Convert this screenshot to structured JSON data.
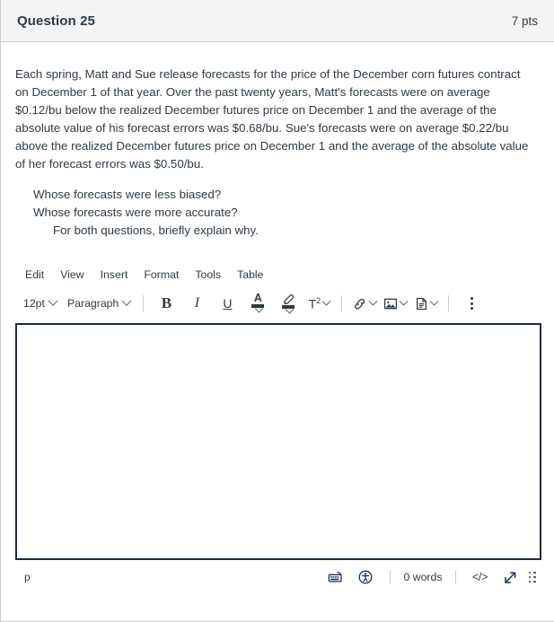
{
  "header": {
    "title": "Question 25",
    "points": "7 pts"
  },
  "question": {
    "paragraph": "Each spring, Matt and Sue release forecasts for the price of the December corn futures contract on December 1 of that year. Over the past twenty years, Matt's forecasts were on average $0.12/bu below the realized December futures price on December 1 and the average of the absolute value of his forecast errors was $0.68/bu. Sue's forecasts were on average $0.22/bu above the realized December futures price on December 1 and the average of the absolute value of her forecast errors was $0.50/bu.",
    "sub_questions": [
      "Whose forecasts were less biased?",
      "Whose forecasts were more accurate?",
      "For both questions, briefly explain why."
    ]
  },
  "editor": {
    "menubar": [
      "Edit",
      "View",
      "Insert",
      "Format",
      "Tools",
      "Table"
    ],
    "toolbar": {
      "font_size": "12pt",
      "block_format": "Paragraph",
      "bold": "B",
      "italic": "I",
      "underline": "U",
      "text_color_glyph": "A",
      "superscript_glyph": "T",
      "superscript_exponent": "2",
      "icons": {
        "text_color": "text-color-icon",
        "highlight": "highlighter-icon",
        "superscript": "superscript-icon",
        "link": "link-icon",
        "image": "image-icon",
        "document": "document-icon",
        "more": "more-options-icon"
      }
    },
    "content": "",
    "statusbar": {
      "element_path": "p",
      "word_count": "0 words",
      "keyboard_icon": "keyboard-shortcuts-icon",
      "accessibility_icon": "accessibility-checker-icon",
      "html_editor_glyph": "</>",
      "fullscreen_icon": "expand-arrow-icon",
      "resize_handle": "resize-grip-icon"
    }
  },
  "colors": {
    "text": "#2d3b45",
    "header_bg": "#f5f5f5",
    "border": "#c7cdd1",
    "editor_focus_border": "#1b2a43"
  }
}
